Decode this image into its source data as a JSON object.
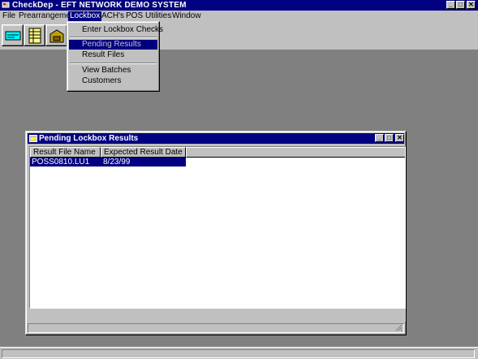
{
  "window": {
    "title": "CheckDep - EFT NETWORK DEMO SYSTEM",
    "minimize": "_",
    "maximize": "□",
    "close": "✕"
  },
  "menubar": {
    "items": [
      "File",
      "Prearrangement",
      "Lockbox",
      "ACH's",
      "POS",
      "Utilities",
      "Window"
    ]
  },
  "toolbar": {
    "buttons": [
      "deposit-icon",
      "ledger-icon",
      "lockbox-icon"
    ]
  },
  "lockbox_menu": {
    "items": [
      "Enter Lockbox Checks",
      "Pending Results",
      "Result Files",
      "View Batches",
      "Customers"
    ],
    "selected": "Pending Results"
  },
  "child_window": {
    "title": "Pending Lockbox Results",
    "columns": [
      "Result File Name",
      "Expected Result Date"
    ],
    "rows": [
      {
        "file": "POSS0810.LU1",
        "date": "8/23/99"
      }
    ]
  },
  "colors": {
    "titlebar": "#000080",
    "face": "#c0c0c0",
    "desktop": "#808080"
  }
}
